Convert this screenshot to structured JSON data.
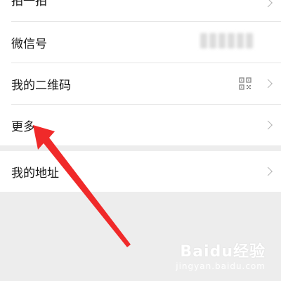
{
  "menu": {
    "top_item_label": "拍一拍",
    "items": [
      {
        "label": "微信号"
      },
      {
        "label": "我的二维码"
      },
      {
        "label": "更多"
      }
    ],
    "address_item_label": "我的地址"
  },
  "icons": {
    "chevron": "chevron-right-icon",
    "qr": "qr-code-icon"
  },
  "annotation": {
    "arrow_color": "#f02a2a"
  },
  "watermark": {
    "brand": "Baidu经验",
    "sub": "jingyan.baidu.com"
  }
}
